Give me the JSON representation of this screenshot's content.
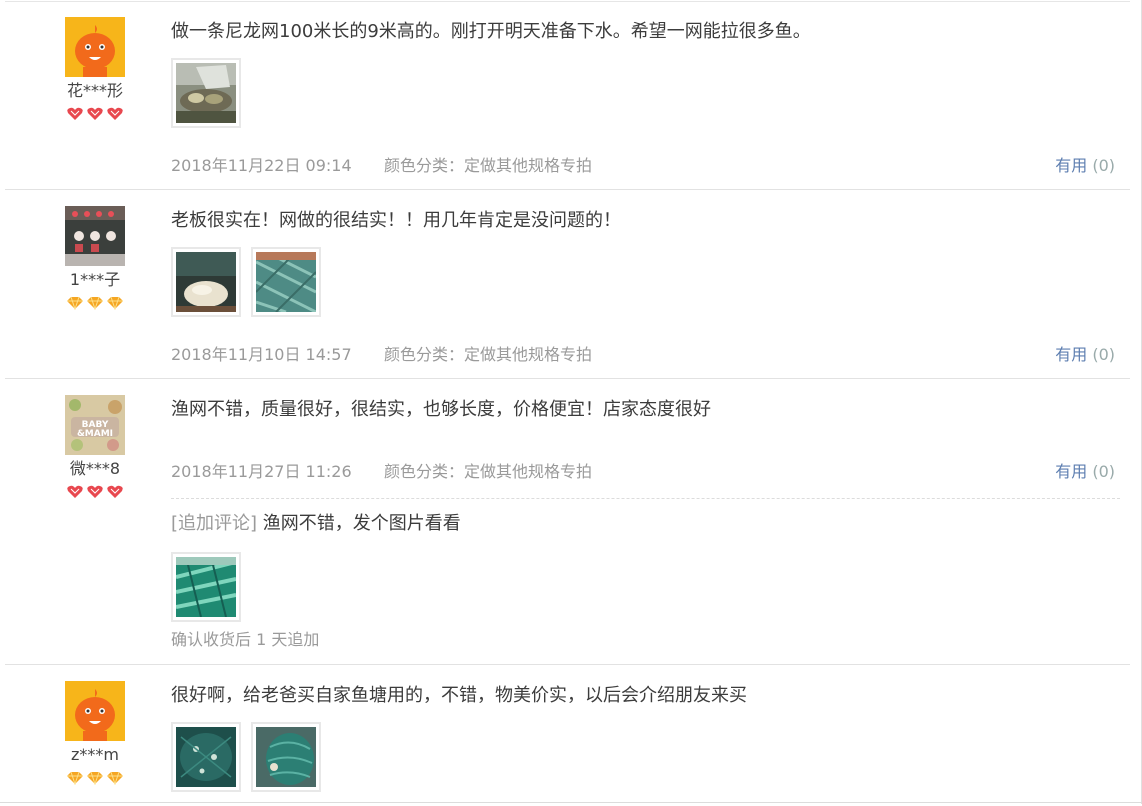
{
  "reviews": [
    {
      "nick": "花***形",
      "text": "做一条尼龙网100米长的9米高的。刚打开明天准备下水。希望一网能拉很多鱼。",
      "date": "2018年11月22日 09:14",
      "sku": "颜色分类：定做其他规格专拍",
      "useful": "有用",
      "useful_count": "(0)",
      "rank_color": "#e8484f",
      "pic_icons": [
        "photo-thumb-net-bag"
      ]
    },
    {
      "nick": "1***子",
      "text": "老板很实在！网做的很结实！！用几年肯定是没问题的！",
      "date": "2018年11月10日 14:57",
      "sku": "颜色分类：定做其他规格专拍",
      "useful": "有用",
      "useful_count": "(0)",
      "rank_color": "#f5a623",
      "pic_icons": [
        "photo-thumb-net-ball",
        "photo-thumb-net-green"
      ]
    },
    {
      "nick": "微***8",
      "text": "渔网不错，质量很好，很结实，也够长度，价格便宜！店家态度很好",
      "date": "2018年11月27日 11:26",
      "sku": "颜色分类：定做其他规格专拍",
      "useful": "有用",
      "useful_count": "(0)",
      "rank_color": "#e8484f",
      "append_tag": "[追加评论]",
      "append_text": "渔网不错，发个图片看看",
      "append_note": "确认收货后 1 天追加",
      "pic_icons": [
        "photo-thumb-net-teal"
      ]
    },
    {
      "nick": "z***m",
      "text": "很好啊，给老爸买自家鱼塘用的，不错，物美价实，以后会介绍朋友来买",
      "rank_color": "#f5a623",
      "pic_icons": [
        "photo-thumb-net-dark",
        "photo-thumb-net-roll"
      ]
    }
  ]
}
